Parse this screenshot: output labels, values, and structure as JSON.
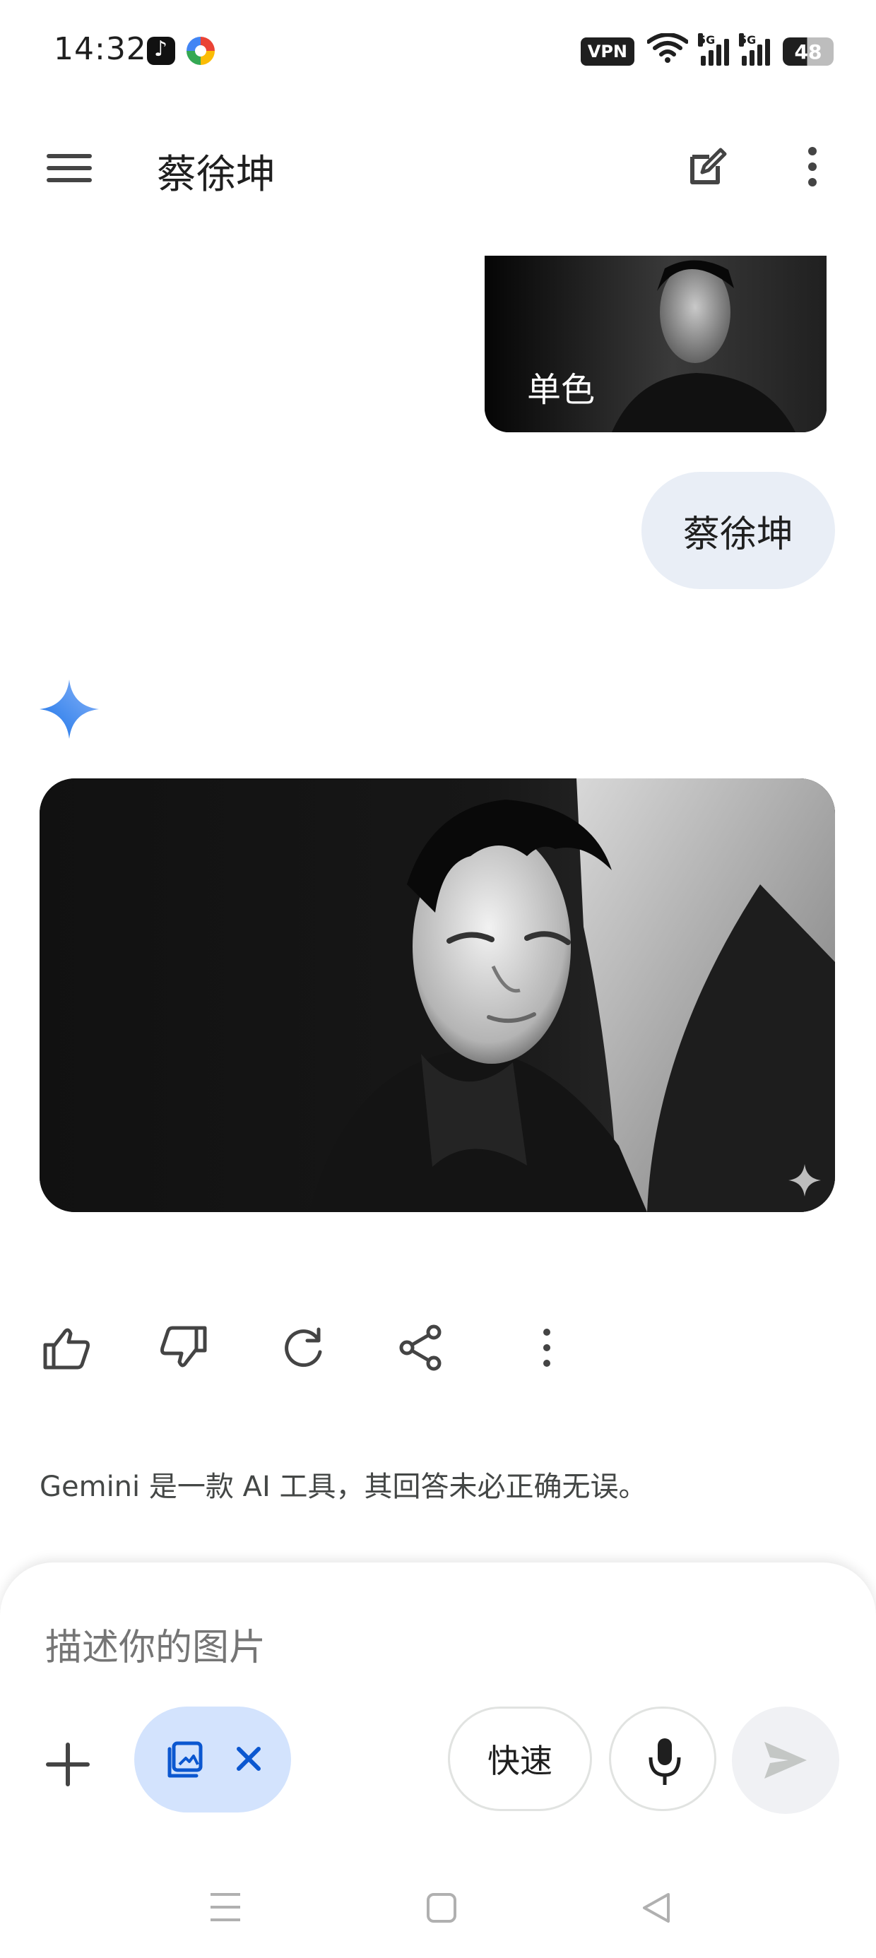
{
  "status_bar": {
    "time": "14:32",
    "vpn": "VPN",
    "network_1": "5G",
    "network_2": "5G",
    "battery": "48",
    "app_icons": [
      "tiktok-icon",
      "multicolor-app-icon"
    ],
    "status_icons": [
      "wifi-icon",
      "signal-icon",
      "battery-icon"
    ]
  },
  "header": {
    "title": "蔡徐坤",
    "icons": [
      "menu-icon",
      "edit-icon",
      "more-vertical-icon"
    ]
  },
  "conversation": {
    "user_image_label": "单色",
    "user_prompt": "蔡徐坤",
    "assistant_icon": "gemini-spark-icon",
    "result_watermark_icon": "sparkle-watermark-icon"
  },
  "actions": {
    "icons": [
      "thumbs-up-icon",
      "thumbs-down-icon",
      "regenerate-icon",
      "share-icon",
      "more-vertical-icon"
    ]
  },
  "disclaimer": "Gemini 是一款 AI 工具，其回答未必正确无误。",
  "composer": {
    "placeholder": "描述你的图片",
    "mode_label": "快速",
    "icons": [
      "add-icon",
      "image-mode-icon",
      "close-icon",
      "microphone-icon",
      "send-icon"
    ],
    "accent_chip_color": "#d3e3fd"
  },
  "navigation": {
    "icons": [
      "recents-icon",
      "home-icon",
      "back-icon"
    ]
  },
  "colors": {
    "gemini_blue": "#4285f4",
    "bubble_background": "#e9eef6",
    "text_primary": "#1f1f1f"
  }
}
